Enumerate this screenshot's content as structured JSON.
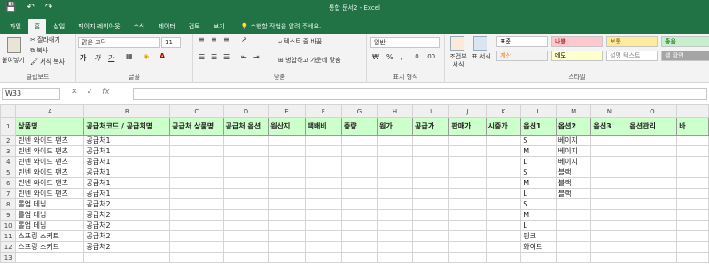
{
  "qat": {
    "save": "💾",
    "undo": "↶",
    "redo": "↷"
  },
  "window": {
    "title": "통합 문서2 - Excel"
  },
  "tabs": [
    "파일",
    "홈",
    "삽입",
    "페이지 레이아웃",
    "수식",
    "데이터",
    "검토",
    "보기"
  ],
  "tell_me": "수행할 작업을 알려 주세요.",
  "ribbon": {
    "clipboard": {
      "paste": "붙여넣기",
      "cut": "잘라내기",
      "copy": "복사",
      "format_painter": "서식 복사",
      "label": "클립보드"
    },
    "font": {
      "name": "맑은 고딕",
      "size": "11",
      "bold": "가",
      "italic": "가",
      "underline": "가",
      "label": "글꼴"
    },
    "alignment": {
      "wrap": "텍스트 줄 바꿈",
      "merge": "병합하고 가운데 맞춤",
      "label": "맞춤"
    },
    "number": {
      "format": "일반",
      "label": "표시 형식"
    },
    "styles": {
      "conditional": "조건부 서식",
      "table": "표 서식",
      "cells": [
        {
          "text": "표준",
          "bg": "#ffffff",
          "color": "#000000"
        },
        {
          "text": "나쁨",
          "bg": "#ffc7ce",
          "color": "#9c0006"
        },
        {
          "text": "보통",
          "bg": "#ffeb9c",
          "color": "#9c5700"
        },
        {
          "text": "좋음",
          "bg": "#c6efce",
          "color": "#006100"
        },
        {
          "text": "계산",
          "bg": "#f2f2f2",
          "color": "#fa7d00"
        },
        {
          "text": "메모",
          "bg": "#ffffcc",
          "color": "#000000"
        },
        {
          "text": "설명 텍스트",
          "bg": "#ffffff",
          "color": "#7f7f7f"
        },
        {
          "text": "셀 확인",
          "bg": "#a5a5a5",
          "color": "#ffffff"
        }
      ],
      "label": "스타일"
    }
  },
  "formula_bar": {
    "name_box": "W33",
    "formula": ""
  },
  "columns": [
    "A",
    "B",
    "C",
    "D",
    "E",
    "F",
    "G",
    "H",
    "I",
    "J",
    "K",
    "L",
    "M",
    "N",
    "O"
  ],
  "header_row": [
    "상품명",
    "공급처코드 / 공급처명",
    "공급처 상품명",
    "공급처 옵션",
    "원산지",
    "택배비",
    "중량",
    "원가",
    "공급가",
    "판매가",
    "시중가",
    "옵션1",
    "옵션2",
    "옵션3",
    "옵션관리",
    "바"
  ],
  "rows": [
    [
      "린넨 와이드 팬츠",
      "공급처1",
      "",
      "",
      "",
      "",
      "",
      "",
      "",
      "",
      "",
      "S",
      "베이지",
      "",
      ""
    ],
    [
      "린넨 와이드 팬츠",
      "공급처1",
      "",
      "",
      "",
      "",
      "",
      "",
      "",
      "",
      "",
      "M",
      "베이지",
      "",
      ""
    ],
    [
      "린넨 와이드 팬츠",
      "공급처1",
      "",
      "",
      "",
      "",
      "",
      "",
      "",
      "",
      "",
      "L",
      "베이지",
      "",
      ""
    ],
    [
      "린넨 와이드 팬츠",
      "공급처1",
      "",
      "",
      "",
      "",
      "",
      "",
      "",
      "",
      "",
      "S",
      "블랙",
      "",
      ""
    ],
    [
      "린넨 와이드 팬츠",
      "공급처1",
      "",
      "",
      "",
      "",
      "",
      "",
      "",
      "",
      "",
      "M",
      "블랙",
      "",
      ""
    ],
    [
      "린넨 와이드 팬츠",
      "공급처1",
      "",
      "",
      "",
      "",
      "",
      "",
      "",
      "",
      "",
      "L",
      "블랙",
      "",
      ""
    ],
    [
      "롤업 데님",
      "공급처2",
      "",
      "",
      "",
      "",
      "",
      "",
      "",
      "",
      "",
      "S",
      "",
      "",
      ""
    ],
    [
      "롤업 데님",
      "공급처2",
      "",
      "",
      "",
      "",
      "",
      "",
      "",
      "",
      "",
      "M",
      "",
      "",
      ""
    ],
    [
      "롤업 데님",
      "공급처2",
      "",
      "",
      "",
      "",
      "",
      "",
      "",
      "",
      "",
      "L",
      "",
      "",
      ""
    ],
    [
      "스프링 스커트",
      "공급처2",
      "",
      "",
      "",
      "",
      "",
      "",
      "",
      "",
      "",
      "핑크",
      "",
      "",
      ""
    ],
    [
      "스프링 스커트",
      "공급처2",
      "",
      "",
      "",
      "",
      "",
      "",
      "",
      "",
      "",
      "화이트",
      "",
      "",
      ""
    ]
  ],
  "row_numbers": [
    "1",
    "2",
    "3",
    "4",
    "5",
    "6",
    "7",
    "8",
    "9",
    "10",
    "11",
    "12",
    "13"
  ]
}
